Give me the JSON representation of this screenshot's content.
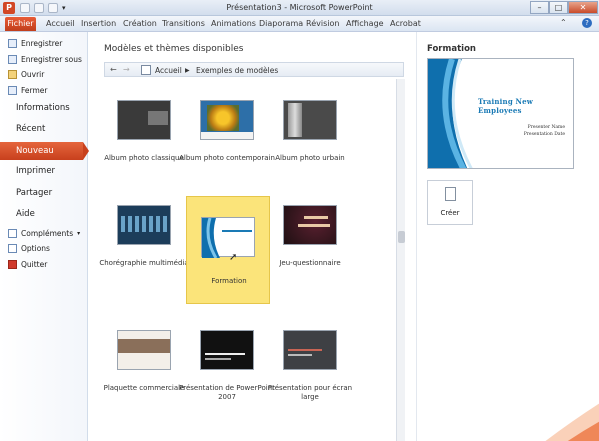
{
  "window": {
    "title": "Présentation3 - Microsoft PowerPoint",
    "app_letter": "P"
  },
  "ribbon": {
    "file_tab": "Fichier",
    "tabs": [
      "Accueil",
      "Insertion",
      "Création",
      "Transitions",
      "Animations",
      "Diaporama",
      "Révision",
      "Affichage",
      "Acrobat"
    ]
  },
  "sidebar": {
    "quick_items": [
      {
        "label": "Enregistrer",
        "icon": "save-icon"
      },
      {
        "label": "Enregistrer sous",
        "icon": "save-as-icon"
      },
      {
        "label": "Ouvrir",
        "icon": "open-folder-icon"
      },
      {
        "label": "Fermer",
        "icon": "close-file-icon"
      }
    ],
    "sections": [
      "Informations",
      "Récent",
      "Nouveau",
      "Imprimer",
      "Partager",
      "Aide"
    ],
    "selected": "Nouveau",
    "bottom_items": [
      {
        "label": "Compléments",
        "icon": "addins-icon"
      },
      {
        "label": "Options",
        "icon": "options-icon"
      },
      {
        "label": "Quitter",
        "icon": "exit-icon"
      }
    ]
  },
  "main": {
    "heading": "Modèles et thèmes disponibles",
    "breadcrumb": [
      "Accueil",
      "Exemples de modèles"
    ],
    "templates": [
      {
        "label": "Album photo classique"
      },
      {
        "label": "Album photo contemporain"
      },
      {
        "label": "Album photo urbain"
      },
      {
        "label": "Chorégraphie multimédia"
      },
      {
        "label": "Formation",
        "selected": true
      },
      {
        "label": "Jeu-questionnaire"
      },
      {
        "label": "Plaquette commerciale"
      },
      {
        "label": "Présentation de PowerPoint 2007"
      },
      {
        "label": "Présentation pour écran large"
      }
    ]
  },
  "preview": {
    "title": "Formation",
    "slide_heading": "Training New Employees",
    "slide_sub1": "Presenter Name",
    "slide_sub2": "Presentation Date",
    "create_label": "Créer"
  },
  "colors": {
    "accent": "#c8401d",
    "selection": "#fbe47a",
    "slide_blue": "#1a7ab5"
  }
}
